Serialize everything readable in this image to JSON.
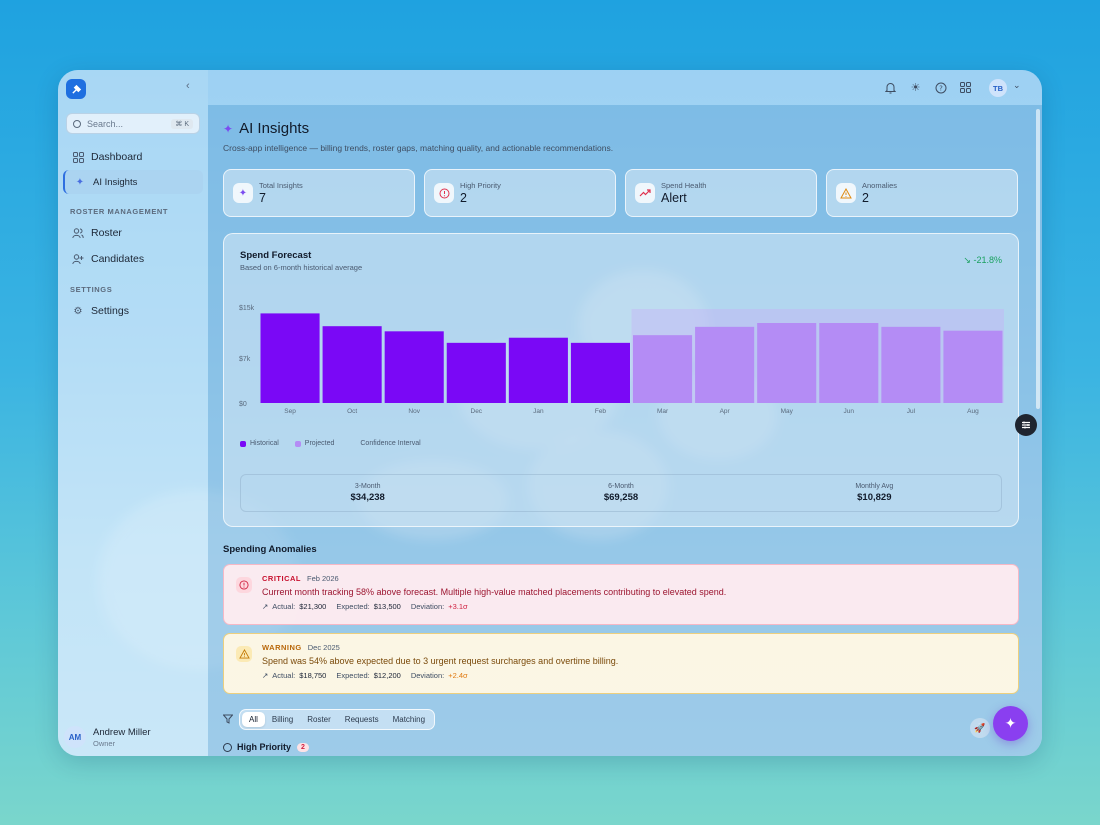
{
  "sidebar": {
    "search_placeholder": "Search...",
    "search_shortcut": "⌘ K",
    "nav_top": [
      {
        "label": "Dashboard"
      },
      {
        "label": "AI Insights"
      }
    ],
    "sections": [
      {
        "title": "ROSTER MANAGEMENT",
        "items": [
          {
            "label": "Roster"
          },
          {
            "label": "Candidates"
          }
        ]
      },
      {
        "title": "SETTINGS",
        "items": [
          {
            "label": "Settings"
          }
        ]
      }
    ],
    "user": {
      "initials": "AM",
      "name": "Andrew Miller",
      "role": "Owner"
    }
  },
  "topbar": {
    "avatar": "TB"
  },
  "page": {
    "title": "AI Insights",
    "subtitle": "Cross-app intelligence — billing trends, roster gaps, matching quality, and actionable recommendations."
  },
  "stats": [
    {
      "label": "Total Insights",
      "value": "7",
      "icon": "sparkles-icon",
      "color": "#7b4df0"
    },
    {
      "label": "High Priority",
      "value": "2",
      "icon": "alert-circle-icon",
      "color": "#e0304d"
    },
    {
      "label": "Spend Health",
      "value": "Alert",
      "icon": "trending-up-icon",
      "color": "#e0304d"
    },
    {
      "label": "Anomalies",
      "value": "2",
      "icon": "warning-triangle-icon",
      "color": "#e08a10"
    }
  ],
  "forecast": {
    "title": "Spend Forecast",
    "subtitle": "Based on 6-month historical average",
    "change": "-21.8%",
    "legend": [
      "Historical",
      "Projected",
      "Confidence Interval"
    ],
    "summary": [
      {
        "label": "3-Month",
        "value": "$34,238"
      },
      {
        "label": "6-Month",
        "value": "$69,258"
      },
      {
        "label": "Monthly Avg",
        "value": "$10,829"
      }
    ]
  },
  "chart_data": {
    "type": "bar",
    "categories": [
      "Sep",
      "Oct",
      "Nov",
      "Dec",
      "Jan",
      "Feb",
      "Mar",
      "Apr",
      "May",
      "Jun",
      "Jul",
      "Aug"
    ],
    "series": [
      {
        "name": "Historical",
        "values": [
          14000,
          12000,
          11200,
          9400,
          10200,
          9400,
          null,
          null,
          null,
          null,
          null,
          null
        ]
      },
      {
        "name": "Projected",
        "values": [
          null,
          null,
          null,
          null,
          null,
          null,
          10600,
          11900,
          12500,
          12500,
          11900,
          11300
        ]
      }
    ],
    "yticks": [
      "$15k",
      "$7k",
      "$0"
    ],
    "ylim": [
      0,
      15000
    ],
    "colors": {
      "historical": "#7a08f6",
      "projected": "#b48cf5",
      "confidence": "rgba(200,170,250,0.35)"
    }
  },
  "anomalies": {
    "title": "Spending Anomalies",
    "items": [
      {
        "severity": "CRITICAL",
        "date": "Feb 2026",
        "message": "Current month tracking 58% above forecast. Multiple high-value matched placements contributing to elevated spend.",
        "actual_label": "Actual:",
        "actual": "$21,300",
        "expected_label": "Expected:",
        "expected": "$13,500",
        "deviation_label": "Deviation:",
        "deviation": "+3.1σ"
      },
      {
        "severity": "WARNING",
        "date": "Dec 2025",
        "message": "Spend was 54% above expected due to 3 urgent request surcharges and overtime billing.",
        "actual_label": "Actual:",
        "actual": "$18,750",
        "expected_label": "Expected:",
        "expected": "$12,200",
        "deviation_label": "Deviation:",
        "deviation": "+2.4σ"
      }
    ]
  },
  "filters": {
    "tabs": [
      "All",
      "Billing",
      "Roster",
      "Requests",
      "Matching"
    ],
    "active": "All"
  },
  "high_priority": {
    "label": "High Priority",
    "count": "2"
  }
}
